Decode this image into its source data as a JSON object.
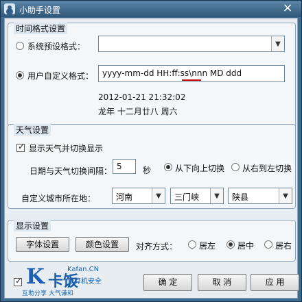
{
  "window": {
    "title": "小助手设置",
    "close_icon": "×"
  },
  "time_format": {
    "group_title": "时间格式设置",
    "system_preset_label": "系统预设格式：",
    "system_preset_value": "",
    "custom_label": "用户自定义格式：",
    "custom_value": "yyyy-mm-dd HH:ff:ss\\nnn MD ddd",
    "preview_line1": "2012-01-21 21:32:02",
    "preview_line2": "龙年 十二月廿八 周六"
  },
  "weather": {
    "group_title": "天气设置",
    "show_weather_label": "显示天气并切换显示",
    "interval_label": "日期与天气切换间隔：",
    "interval_value": "5",
    "interval_unit": "秒",
    "bottom_up_label": "从下向上切换",
    "right_left_label": "从右到左切换",
    "city_label": "自定义城市所在地：",
    "province": "河南",
    "city": "三门峡",
    "county": "陕县"
  },
  "display": {
    "group_title": "显示设置",
    "font_button": "字体设置",
    "color_button": "颜色设置",
    "align_label": "对齐方式：",
    "align_left": "居左",
    "align_center": "居中",
    "align_right": "居右"
  },
  "footer": {
    "ok": "确 定",
    "cancel": "取 消",
    "apply": "应 用"
  },
  "watermark": {
    "mark": "K",
    "cn": "卡饭",
    "site": "Kafan.CN",
    "subtitle": "计算机安全",
    "bottom": "互助分享  大气谦和"
  }
}
